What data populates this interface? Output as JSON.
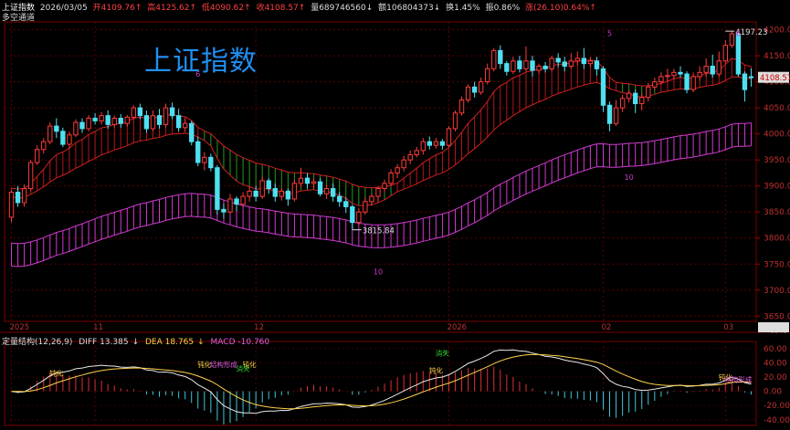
{
  "header": {
    "name": "上证指数",
    "date": "2026/03/05",
    "open": "开4109.76↑",
    "high": "高4125.62↑",
    "low": "低4090.62↑",
    "close": "收4108.57↑",
    "volume": "量689746560↓",
    "amount": "额1068043​73↓",
    "turnover": "换1.45%",
    "amplitude": "振0.86%",
    "change": "涨(26.10)0.64%↑",
    "sub_label": "多空通道",
    "big_title": "上证指数"
  },
  "colors": {
    "up": "#ff3b3b",
    "down": "#4fe0f0",
    "ma_mid": "#33c233",
    "channel": "#d03ad0",
    "text_y": "#ffd24a"
  },
  "chart_data": [
    {
      "type": "candlestick",
      "title": "上证指数",
      "y_ticks": [
        3650,
        3700,
        3750,
        3800,
        3850,
        3900,
        3950,
        4000,
        4050,
        4100,
        4150,
        4200
      ],
      "ylim": [
        3640,
        4215
      ],
      "x_labels": [
        {
          "label": "2025",
          "index": 0
        },
        {
          "label": "11",
          "index": 13
        },
        {
          "label": "12",
          "index": 38
        },
        {
          "label": "2026",
          "index": 68
        },
        {
          "label": "02",
          "index": 92
        },
        {
          "label": "03",
          "index": 111
        }
      ],
      "price_marker": "4108.57",
      "annotations": [
        {
          "text": "4197.23",
          "index": 111,
          "value": 4197.23
        },
        {
          "text": "3815.84",
          "index": 53,
          "value": 3815.84
        },
        {
          "text": "6",
          "index": 29,
          "value": 4110
        },
        {
          "text": "10",
          "index": 57,
          "value": 3730
        },
        {
          "text": "5",
          "index": 93,
          "value": 4188
        },
        {
          "text": "10",
          "index": 96,
          "value": 3912
        },
        {
          "text": "6",
          "index": 113,
          "value": 4188
        }
      ],
      "candles": [
        [
          3840,
          3888,
          3830,
          3892
        ],
        [
          3888,
          3868,
          3860,
          3900
        ],
        [
          3868,
          3895,
          3860,
          3903
        ],
        [
          3895,
          3945,
          3890,
          3950
        ],
        [
          3945,
          3970,
          3940,
          3978
        ],
        [
          3970,
          3985,
          3962,
          3992
        ],
        [
          3985,
          4015,
          3980,
          4022
        ],
        [
          4015,
          4005,
          3992,
          4030
        ],
        [
          4005,
          3980,
          3975,
          4012
        ],
        [
          3980,
          3998,
          3972,
          4004
        ],
        [
          3998,
          4022,
          3994,
          4028
        ],
        [
          4022,
          4010,
          4002,
          4030
        ],
        [
          4010,
          4030,
          4005,
          4036
        ],
        [
          4030,
          4025,
          4018,
          4040
        ],
        [
          4025,
          4035,
          4018,
          4042
        ],
        [
          4035,
          4018,
          4010,
          4045
        ],
        [
          4018,
          4030,
          4012,
          4035
        ],
        [
          4030,
          4020,
          4012,
          4038
        ],
        [
          4020,
          4032,
          4014,
          4036
        ],
        [
          4032,
          4050,
          4028,
          4055
        ],
        [
          4050,
          4035,
          4028,
          4058
        ],
        [
          4035,
          4010,
          4002,
          4045
        ],
        [
          4010,
          4035,
          4005,
          4045
        ],
        [
          4035,
          4018,
          4010,
          4048
        ],
        [
          4018,
          4050,
          4012,
          4058
        ],
        [
          4050,
          4035,
          4028,
          4060
        ],
        [
          4035,
          4012,
          4005,
          4048
        ],
        [
          4012,
          4020,
          4005,
          4030
        ],
        [
          4020,
          3985,
          3978,
          4025
        ],
        [
          3985,
          3945,
          3938,
          3995
        ],
        [
          3945,
          3955,
          3930,
          3965
        ],
        [
          3955,
          3935,
          3928,
          3962
        ],
        [
          3935,
          3855,
          3845,
          3940
        ],
        [
          3855,
          3850,
          3838,
          3866
        ],
        [
          3850,
          3875,
          3845,
          3885
        ],
        [
          3875,
          3865,
          3852,
          3880
        ],
        [
          3865,
          3880,
          3860,
          3888
        ],
        [
          3880,
          3890,
          3870,
          3898
        ],
        [
          3890,
          3880,
          3870,
          3900
        ],
        [
          3880,
          3910,
          3875,
          3918
        ],
        [
          3910,
          3895,
          3885,
          3915
        ],
        [
          3895,
          3880,
          3870,
          3905
        ],
        [
          3880,
          3890,
          3872,
          3896
        ],
        [
          3890,
          3875,
          3862,
          3895
        ],
        [
          3875,
          3905,
          3870,
          3912
        ],
        [
          3905,
          3915,
          3898,
          3935
        ],
        [
          3915,
          3905,
          3895,
          3925
        ],
        [
          3905,
          3908,
          3895,
          3915
        ],
        [
          3908,
          3885,
          3880,
          3915
        ],
        [
          3885,
          3895,
          3875,
          3902
        ],
        [
          3895,
          3880,
          3870,
          3905
        ],
        [
          3880,
          3870,
          3860,
          3888
        ],
        [
          3870,
          3860,
          3848,
          3878
        ],
        [
          3860,
          3830,
          3816,
          3865
        ],
        [
          3830,
          3850,
          3825,
          3858
        ],
        [
          3850,
          3870,
          3845,
          3878
        ],
        [
          3870,
          3880,
          3862,
          3885
        ],
        [
          3880,
          3895,
          3870,
          3900
        ],
        [
          3895,
          3905,
          3888,
          3912
        ],
        [
          3905,
          3925,
          3900,
          3932
        ],
        [
          3925,
          3935,
          3915,
          3942
        ],
        [
          3935,
          3950,
          3928,
          3958
        ],
        [
          3950,
          3960,
          3942,
          3968
        ],
        [
          3960,
          3968,
          3955,
          3975
        ],
        [
          3968,
          3985,
          3960,
          3992
        ],
        [
          3985,
          3978,
          3970,
          3995
        ],
        [
          3978,
          3985,
          3972,
          3992
        ],
        [
          3985,
          3978,
          3970,
          3990
        ],
        [
          3978,
          4010,
          3975,
          4015
        ],
        [
          4010,
          4040,
          4005,
          4045
        ],
        [
          4040,
          4065,
          4035,
          4072
        ],
        [
          4065,
          4090,
          4060,
          4095
        ],
        [
          4090,
          4080,
          4070,
          4100
        ],
        [
          4080,
          4100,
          4075,
          4108
        ],
        [
          4100,
          4125,
          4095,
          4135
        ],
        [
          4125,
          4160,
          4120,
          4165
        ],
        [
          4160,
          4135,
          4125,
          4170
        ],
        [
          4135,
          4120,
          4112,
          4140
        ],
        [
          4120,
          4140,
          4115,
          4148
        ],
        [
          4140,
          4125,
          4118,
          4150
        ],
        [
          4125,
          4140,
          4120,
          4168
        ],
        [
          4140,
          4122,
          4110,
          4150
        ],
        [
          4122,
          4130,
          4115,
          4135
        ],
        [
          4130,
          4125,
          4118,
          4138
        ],
        [
          4125,
          4145,
          4120,
          4150
        ],
        [
          4145,
          4138,
          4128,
          4155
        ],
        [
          4138,
          4130,
          4120,
          4148
        ],
        [
          4130,
          4140,
          4125,
          4155
        ],
        [
          4140,
          4145,
          4132,
          4158
        ],
        [
          4145,
          4135,
          4125,
          4165
        ],
        [
          4135,
          4140,
          4128,
          4148
        ],
        [
          4140,
          4125,
          4112,
          4148
        ],
        [
          4125,
          4055,
          4042,
          4130
        ],
        [
          4055,
          4020,
          4005,
          4062
        ],
        [
          4020,
          4050,
          4015,
          4065
        ],
        [
          4050,
          4068,
          4042,
          4075
        ],
        [
          4068,
          4078,
          4060,
          4085
        ],
        [
          4078,
          4058,
          4040,
          4085
        ],
        [
          4058,
          4070,
          4045,
          4078
        ],
        [
          4070,
          4090,
          4062,
          4098
        ],
        [
          4090,
          4100,
          4085,
          4108
        ],
        [
          4100,
          4110,
          4095,
          4118
        ],
        [
          4110,
          4112,
          4100,
          4125
        ],
        [
          4112,
          4118,
          4105,
          4125
        ],
        [
          4118,
          4115,
          4108,
          4130
        ],
        [
          4115,
          4085,
          4078,
          4120
        ],
        [
          4085,
          4110,
          4080,
          4118
        ],
        [
          4110,
          4118,
          4102,
          4130
        ],
        [
          4118,
          4130,
          4110,
          4145
        ],
        [
          4130,
          4115,
          4108,
          4152
        ],
        [
          4115,
          4140,
          4110,
          4158
        ],
        [
          4140,
          4170,
          4135,
          4180
        ],
        [
          4170,
          4192,
          4165,
          4197.23
        ],
        [
          4192,
          4115,
          4110,
          4195
        ],
        [
          4115,
          4085,
          4062,
          4120
        ],
        [
          4109.76,
          4108.57,
          4090.62,
          4125.62
        ]
      ]
    },
    {
      "type": "macd",
      "title": "定量结构(12,26,9)",
      "params": "(12,26,9)",
      "DIFF": "13.385",
      "DEA": "18.765",
      "MACD": "-10.760",
      "y_ticks": [
        -40,
        -20,
        0,
        20,
        40,
        60
      ],
      "ylim": [
        -48,
        70
      ],
      "signals": [
        {
          "text": "钝化",
          "index": 8,
          "value": 22,
          "color": "#ffd24a"
        },
        {
          "text": "钝化",
          "index": 34,
          "value": 34,
          "color": "#ffd24a"
        },
        {
          "text": "结构形成",
          "index": 37,
          "value": 34,
          "color": "#e060e0"
        },
        {
          "text": "钝化",
          "index": 42,
          "value": 34,
          "color": "#ffd24a"
        },
        {
          "text": "消失",
          "index": 40,
          "value": 28,
          "color": "#33d433"
        },
        {
          "text": "钝化",
          "index": 74,
          "value": 26,
          "color": "#ffd24a"
        },
        {
          "text": "消失",
          "index": 75,
          "value": 50,
          "color": "#33d433"
        },
        {
          "text": "钝化",
          "index": 124,
          "value": 16,
          "color": "#ffd24a"
        },
        {
          "text": "结构形成",
          "index": 127,
          "value": 13,
          "color": "#e060e0"
        }
      ]
    }
  ],
  "period_label": "日线"
}
